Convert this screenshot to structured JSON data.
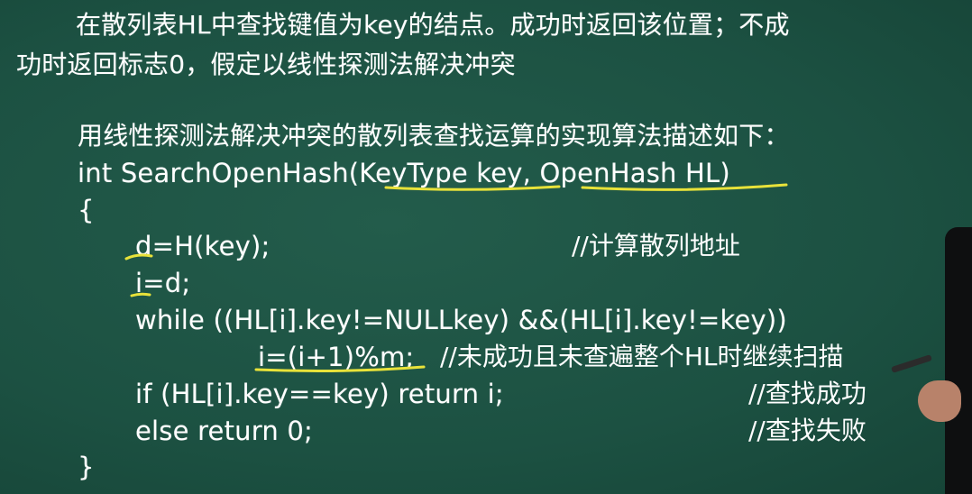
{
  "intro": {
    "line1": "在散列表HL中查找键值为key的结点。成功时返回该位置；不成",
    "line2": "功时返回标志0，假定以线性探测法解决冲突"
  },
  "code": {
    "heading": "用线性探测法解决冲突的散列表查找运算的实现算法描述如下：",
    "signature": "int SearchOpenHash(KeyType key, OpenHash HL)",
    "open_brace": "{",
    "stmt_d": "d=H(key);",
    "comment_d": "//计算散列地址",
    "stmt_i": "i=d;",
    "stmt_while": "while ((HL[i].key!=NULLkey) &&(HL[i].key!=key))",
    "stmt_inc": "i=(i+1)%m;",
    "comment_inc": "//未成功且未查遍整个HL时继续扫描",
    "stmt_if": "if (HL[i].key==key) return i;",
    "comment_if": "//查找成功",
    "stmt_else": "else return 0;",
    "comment_else": "//查找失败",
    "close_brace": "}"
  },
  "colors": {
    "board": "#1c5142",
    "text": "#ffffff",
    "highlight": "#e8e23a"
  },
  "presenter": "teacher-hand-with-pen"
}
